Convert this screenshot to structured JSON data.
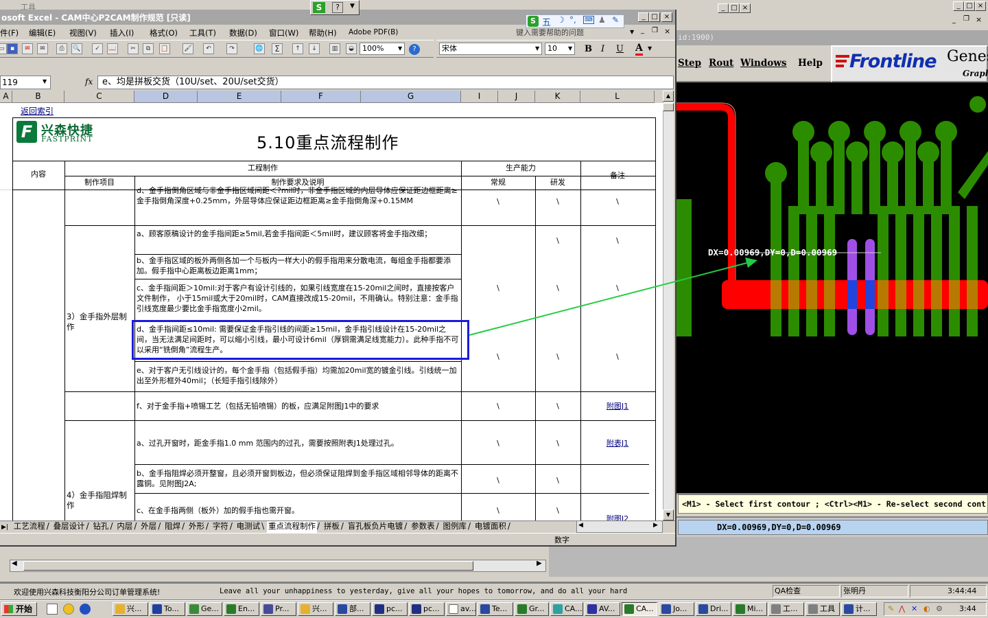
{
  "excel": {
    "title": "osoft Excel - CAM中心P2CAM制作规范 [只读]",
    "menu": [
      "件(F)",
      "编辑(E)",
      "视图(V)",
      "插入(I)",
      "格式(O)",
      "工具(T)",
      "数据(D)",
      "窗口(W)",
      "帮助(H)",
      "Adobe PDF(B)"
    ],
    "help_placeholder": "键入需要帮助的问题",
    "zoom": "100%",
    "font_name": "宋体",
    "font_size": "10",
    "fmt_bold": "B",
    "fmt_italic": "I",
    "fmt_underline": "U",
    "fmt_color": "A",
    "ime_labels": [
      "五",
      "S"
    ],
    "name_box": "119",
    "fx": "fx",
    "formula": "e、均是拼板交货（10U/set、20U/set交货）",
    "columns": [
      "A",
      "B",
      "C",
      "D",
      "E",
      "F",
      "G",
      "I",
      "J",
      "K",
      "L"
    ],
    "back_link": "返回索引",
    "logo_cn": "兴森快捷",
    "logo_en": "FASTPRINT",
    "logo_mark": "F",
    "heading": "5.10重点流程制作",
    "table_headers": {
      "content": "内容",
      "engineering": "工程制作",
      "capability": "生产能力",
      "remark": "备注",
      "item": "制作项目",
      "requirement": "制作要求及说明",
      "normal": "常规",
      "research": "研发"
    },
    "rows": [
      {
        "text": "d、金手指倒角区域与非金手指区域间距＜?mil时，非金手指区域的内层导体应保证距边框距离≥金手指倒角深度+0.25mm，外层导体应保证距边框距离≥金手指倒角深+0.15MM",
        "normal": "\\",
        "research": "\\",
        "remark": "\\"
      },
      {
        "text": "a、顾客原稿设计的金手指间距≥5mil,若金手指间距＜5mil时，建议顾客将金手指改细；",
        "normal": "",
        "research": "\\",
        "remark": "\\"
      },
      {
        "text": "b、金手指区域的板外两侧各加一个与板内一样大小的假手指用来分散电流，每组金手指都要添加。假手指中心距离板边距离1mm；",
        "normal": "",
        "research": "",
        "remark": ""
      },
      {
        "text": "c、金手指间距＞10mil:对于客户有设计引线的，如果引线宽度在15-20mil之间时，直接按客户文件制作， 小于15mil或大于20mil时，CAM直接改成15-20mil，不用确认。特别注意：金手指引线宽度最少要比金手指宽度小2mil。",
        "normal": "\\",
        "research": "\\",
        "remark": "\\"
      },
      {
        "text": "d、金手指间距≤10mil: 需要保证金手指引线的间距≥15mil，金手指引线设计在15-20mil之间，当无法满足间距时，可以缩小引线，最小可设计6mil（厚铜需满足线宽能力）。此种手指不可以采用“铣倒角”流程生产。",
        "normal": "\\",
        "research": "\\",
        "remark": "\\"
      },
      {
        "text": "e、对于客户无引线设计的，每个金手指（包括假手指）均需加20mil宽的镀金引线。引线统一加出至外形框外40mil；（长短手指引线除外）",
        "normal": "",
        "research": "",
        "remark": ""
      },
      {
        "text": "f、对于金手指+喷锡工艺（包括无铅喷锡）的板，应满足附图J1中的要求",
        "normal": "\\",
        "research": "\\",
        "remark": "附图J1"
      },
      {
        "text": "a、过孔开窗时，距金手指1.0 mm 范围内的过孔，需要按照附表J1处理过孔。",
        "normal": "\\",
        "research": "\\",
        "remark": "附表J1"
      },
      {
        "text": "b、金手指阻焊必须开整窗，且必须开窗到板边，但必须保证阻焊到金手指区域相邻导体的距离不露铜。见附图J2A;",
        "normal": "\\",
        "research": "\\",
        "remark": ""
      },
      {
        "text": "c、在金手指两侧（板外）加的假手指也需开窗。",
        "normal": "\\",
        "research": "\\",
        "remark": "附图J2"
      }
    ],
    "section_outer": "3）金手指外层制作",
    "section_mask": "4）金手指阻焊制作",
    "sheet_tabs": [
      "工艺流程",
      "叠层设计",
      "钻孔",
      "内层",
      "外层",
      "阻焊",
      "外形",
      "字符",
      "电测试",
      "重点流程制作",
      "拼板",
      "盲孔板负片电镀",
      "参数表",
      "图例库",
      "电镀面积"
    ],
    "status": "数字"
  },
  "genesis": {
    "title_fragment": "id:1900)",
    "menu": [
      "Step",
      "Rout",
      "Windows",
      "Help"
    ],
    "logo": "Frontline",
    "logo_right": "Genes",
    "logo_sub": "Graph",
    "measure_label": "DX=0.00969,DY=0,D=0.00969",
    "prompt": "<M1> - Select first contour ; <Ctrl><M1> - Re-select second cont",
    "readout": "DX=0.00969,DY=0,D=0.00969"
  },
  "back_app": {
    "title": "工具",
    "status_left": "欢迎使用兴森科技衡阳分公司订单管理系统!",
    "marquee": "Leave all your unhappiness to yesterday, give all your hopes to tomorrow, and do all your hard",
    "status_dept": "QA检查",
    "status_user": "张明丹",
    "status_time": "3:44:44"
  },
  "taskbar": {
    "start": "开始",
    "tasks": [
      "兴...",
      "To...",
      "Ge...",
      "En...",
      "Pr...",
      "兴...",
      "部...",
      "pc...",
      "pc...",
      "av...",
      "Te...",
      "Gr...",
      "CA...",
      "AV...",
      "CA...",
      "Jo...",
      "Dri...",
      "Mi...",
      "工...",
      "工具",
      "计..."
    ],
    "clock": "3:44"
  },
  "colors": {
    "selection_box": "#1a1adc",
    "trace_red": "#ff0000",
    "trace_green": "#2c8c00",
    "pad_purple": "#a04fe6",
    "pad_blue": "#2244dd",
    "pad_orange": "#c87800",
    "arrow": "#22cc44"
  }
}
